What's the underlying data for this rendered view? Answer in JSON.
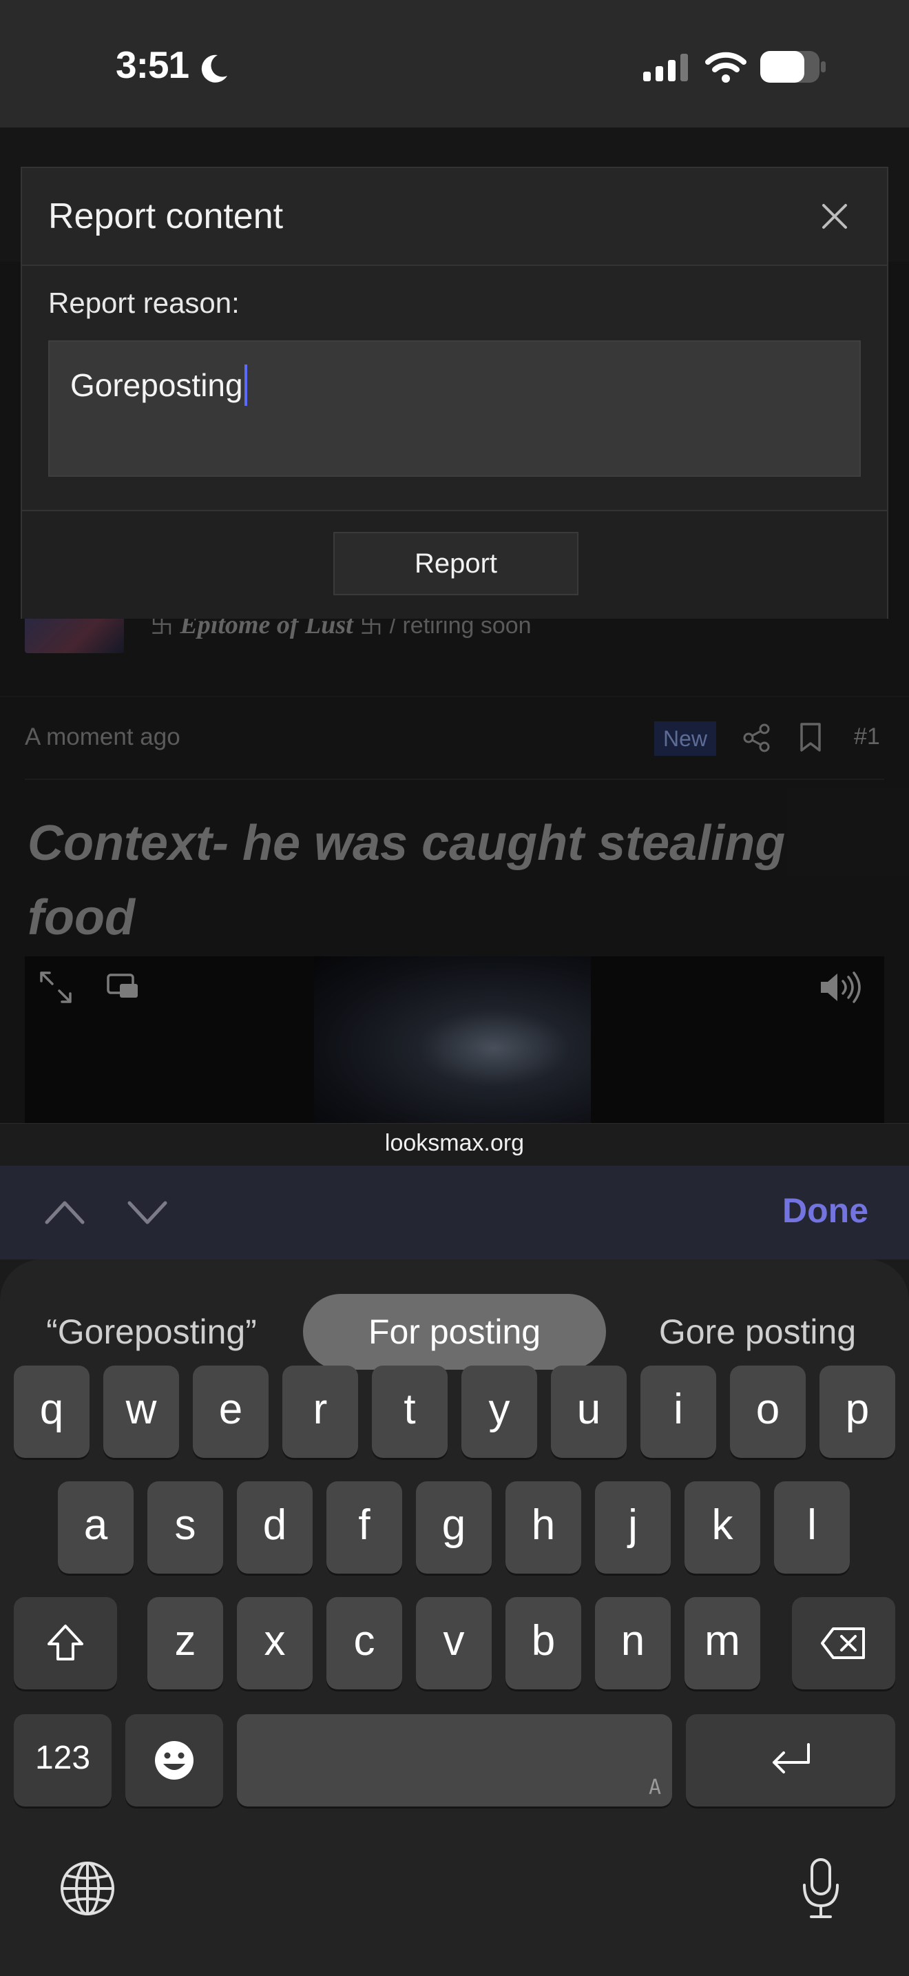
{
  "status_bar": {
    "time": "3:51",
    "icons": [
      "moon-icon",
      "signal-icon",
      "wifi-icon",
      "battery-icon"
    ]
  },
  "post": {
    "author_name": "Epitome of Lust",
    "author_symbol": "卐",
    "author_title": "/ retiring soon",
    "timestamp": "A moment ago",
    "new_badge": "New",
    "post_number": "#1",
    "title": "Context- he was caught stealing food"
  },
  "browser": {
    "url": "looksmax.org"
  },
  "modal": {
    "title": "Report content",
    "reason_label": "Report reason:",
    "reason_value": "Goreposting",
    "submit_label": "Report"
  },
  "keyboard": {
    "done_label": "Done",
    "suggestions": [
      "“Goreposting”",
      "For posting",
      "Gore posting"
    ],
    "row1": [
      "q",
      "w",
      "e",
      "r",
      "t",
      "y",
      "u",
      "i",
      "o",
      "p"
    ],
    "row2": [
      "a",
      "s",
      "d",
      "f",
      "g",
      "h",
      "j",
      "k",
      "l"
    ],
    "row3": [
      "z",
      "x",
      "c",
      "v",
      "b",
      "n",
      "m"
    ],
    "numbers_label": "123",
    "space_hint": "A",
    "accent_color": "#7474e0"
  }
}
